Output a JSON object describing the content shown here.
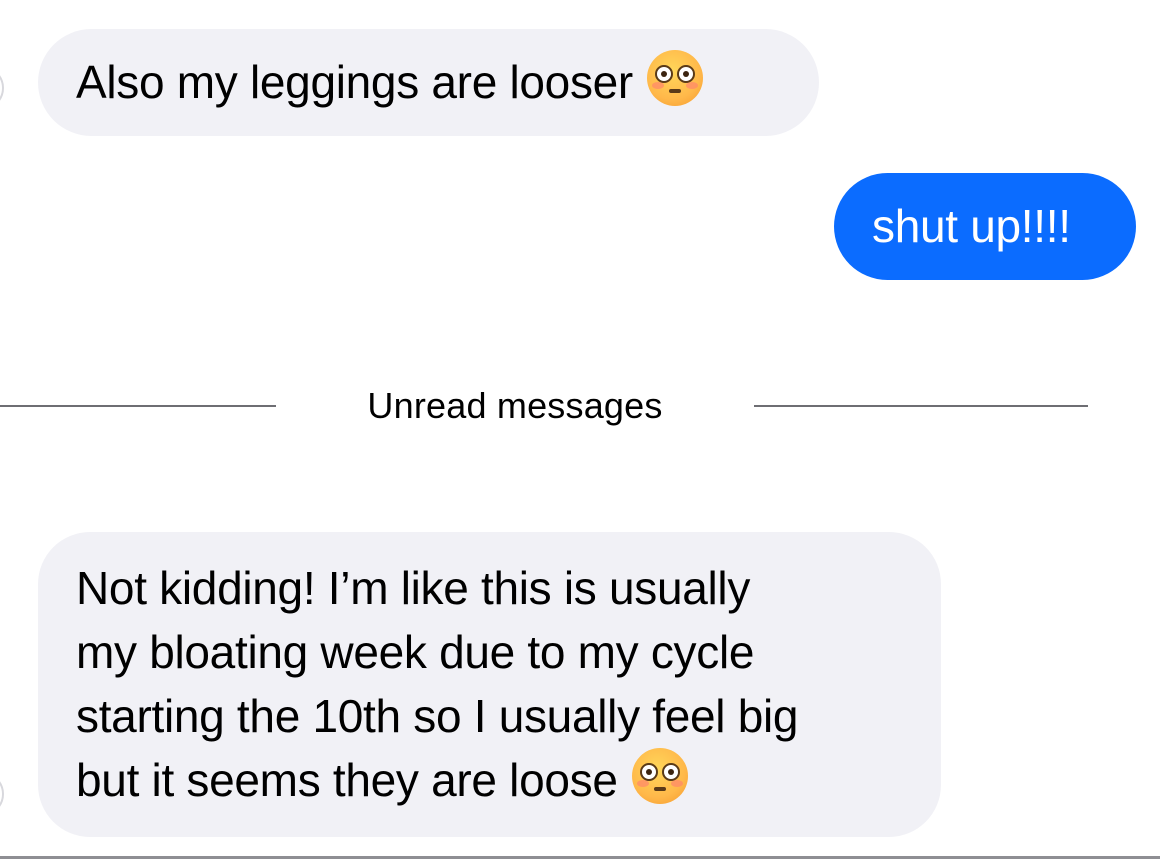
{
  "messages": [
    {
      "direction": "incoming",
      "text": "Also my leggings are looser",
      "emoji": "flushed-face"
    },
    {
      "direction": "outgoing",
      "text": "shut up!!!!"
    },
    {
      "direction": "incoming",
      "lines": [
        "Not kidding! I’m like this is usually",
        "my bloating week due to my cycle",
        "starting the 10th so I usually feel big",
        "but it seems they are loose"
      ],
      "emoji": "flushed-face"
    }
  ],
  "divider": {
    "label": "Unread messages"
  },
  "colors": {
    "incoming_bubble": "#f1f1f6",
    "outgoing_bubble": "#0b6cff",
    "divider_line": "#6e6e73"
  }
}
